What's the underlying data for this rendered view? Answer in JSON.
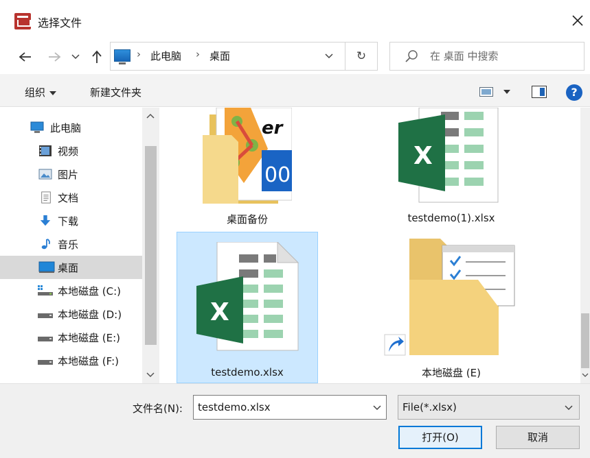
{
  "window": {
    "title": "选择文件",
    "close_label": "✕"
  },
  "nav": {
    "breadcrumbs": [
      "此电脑",
      "桌面"
    ],
    "refresh_glyph": "↻",
    "search_placeholder": "在 桌面 中搜索"
  },
  "toolbar": {
    "organize": "组织",
    "new_folder": "新建文件夹",
    "help": "?"
  },
  "sidebar": {
    "items": [
      {
        "label": "此电脑",
        "icon": "computer-icon"
      },
      {
        "label": "视频",
        "icon": "video-icon"
      },
      {
        "label": "图片",
        "icon": "pictures-icon"
      },
      {
        "label": "文档",
        "icon": "documents-icon"
      },
      {
        "label": "下载",
        "icon": "download-icon"
      },
      {
        "label": "音乐",
        "icon": "music-icon"
      },
      {
        "label": "桌面",
        "icon": "desktop-icon",
        "selected": true
      },
      {
        "label": "本地磁盘 (C:)",
        "icon": "drive-c-icon"
      },
      {
        "label": "本地磁盘 (D:)",
        "icon": "drive-icon"
      },
      {
        "label": "本地磁盘 (E:)",
        "icon": "drive-icon"
      },
      {
        "label": "本地磁盘 (F:)",
        "icon": "drive-icon"
      }
    ]
  },
  "files": [
    {
      "name": "桌面备份",
      "type": "folder"
    },
    {
      "name": "testdemo(1).xlsx",
      "type": "excel"
    },
    {
      "name": "testdemo.xlsx",
      "type": "excel",
      "selected": true
    },
    {
      "name": "本地磁盘 (E)",
      "type": "shortcut-folder"
    }
  ],
  "footer": {
    "filename_label": "文件名(N):",
    "filename_value": "testdemo.xlsx",
    "filetype_value": "File(*.xlsx)",
    "open_label": "打开(O)",
    "cancel_label": "取消"
  },
  "colors": {
    "accent": "#0078d7",
    "selection": "#cce8ff",
    "excel_green": "#1f7145"
  }
}
